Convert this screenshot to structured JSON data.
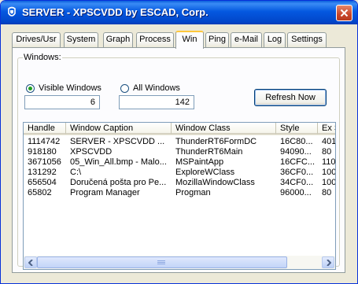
{
  "window": {
    "title": "SERVER - XPSCVDD by ESCAD, Corp."
  },
  "tabs": [
    {
      "label": "Drives/Usr"
    },
    {
      "label": "System"
    },
    {
      "label": "Graph"
    },
    {
      "label": "Process"
    },
    {
      "label": "Win",
      "active": true
    },
    {
      "label": "Ping"
    },
    {
      "label": "e-Mail"
    },
    {
      "label": "Log"
    },
    {
      "label": "Settings"
    }
  ],
  "windows_group": {
    "legend": "Windows:",
    "visible_label": "Visible Windows",
    "visible_selected": true,
    "visible_count": "6",
    "all_label": "All Windows",
    "all_selected": false,
    "all_count": "142",
    "refresh_label": "Refresh Now"
  },
  "listview": {
    "columns": [
      "Handle",
      "Window Caption",
      "Window Class",
      "Style",
      "Ex S"
    ],
    "rows": [
      [
        "1114742",
        "SERVER - XPSCVDD ...",
        "ThunderRT6FormDC",
        "16C80...",
        "401"
      ],
      [
        "918180",
        "XPSCVDD",
        "ThunderRT6Main",
        "94090...",
        "80"
      ],
      [
        "3671056",
        "05_Win_All.bmp - Malo...",
        "MSPaintApp",
        "16CFC...",
        "110"
      ],
      [
        "131292",
        "C:\\",
        "ExploreWClass",
        "36CF0...",
        "100"
      ],
      [
        "656504",
        "Doručená pošta pro Pe...",
        "MozillaWindowClass",
        "34CF0...",
        "100"
      ],
      [
        "65802",
        "Program Manager",
        "Progman",
        "96000...",
        "80"
      ]
    ]
  },
  "icons": {
    "app": "app-icon",
    "close": "close-icon",
    "scroll_left": "scroll-left-icon",
    "scroll_right": "scroll-right-icon"
  }
}
